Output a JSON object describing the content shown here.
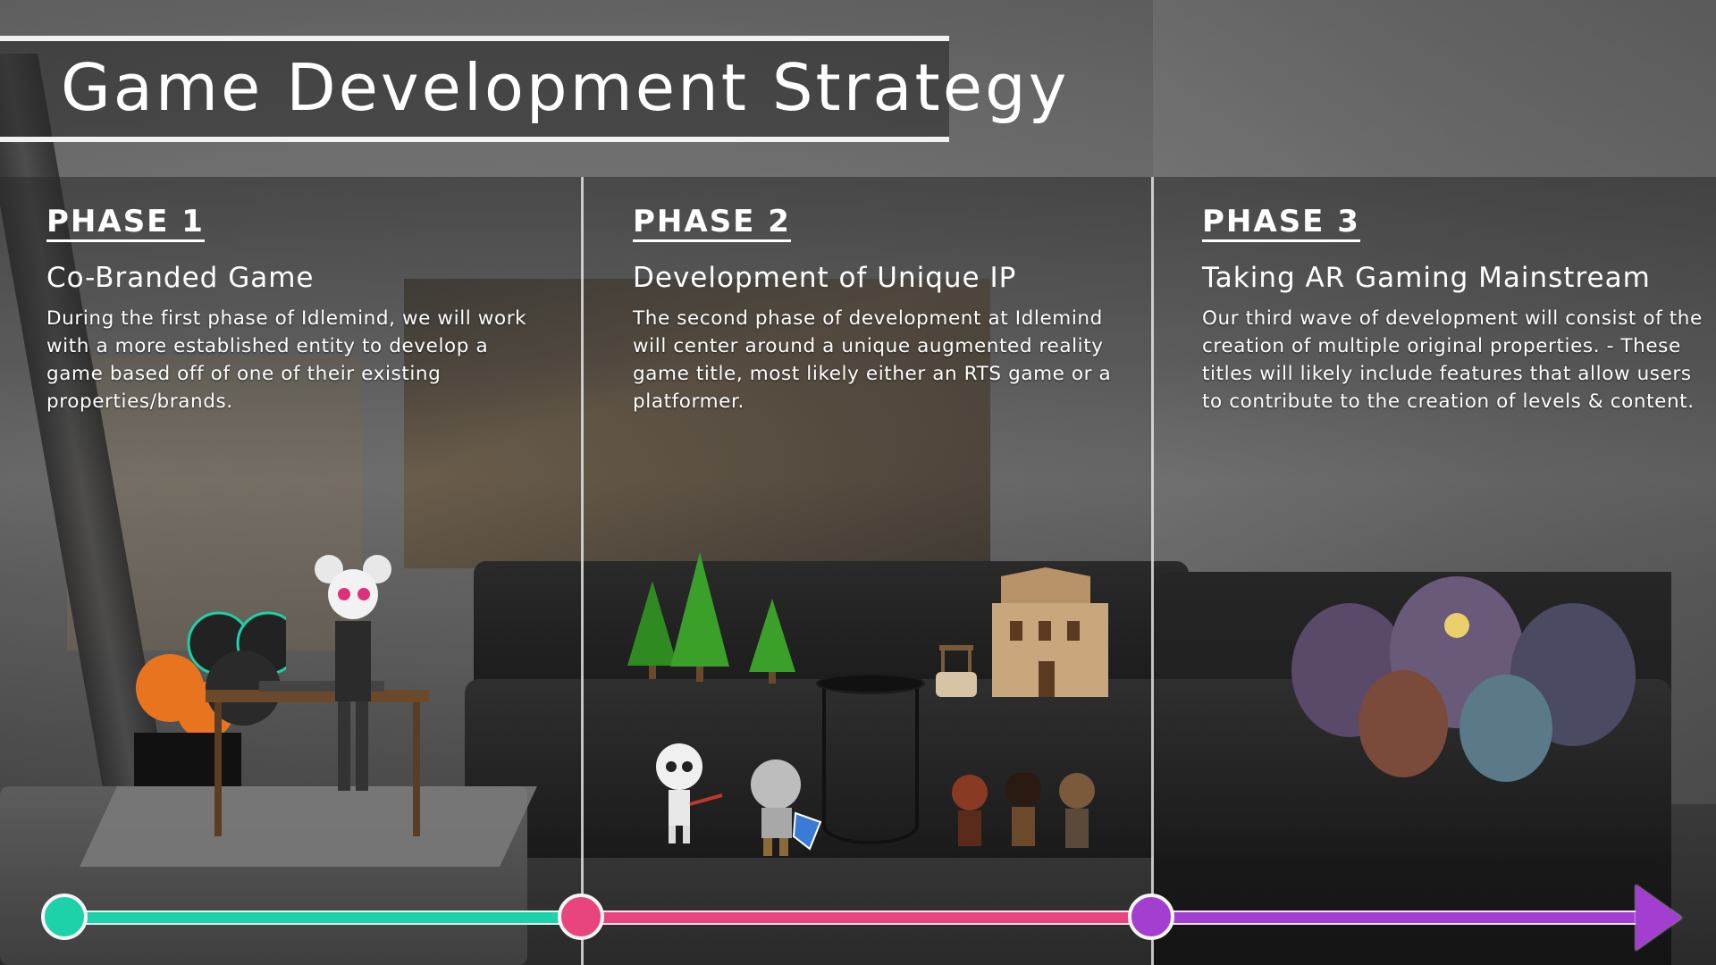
{
  "title": "Game Development Strategy",
  "phases": [
    {
      "label": "PHASE 1",
      "subtitle": "Co-Branded Game",
      "body": "During the first phase of Idlemind, we will work with a more established entity to develop a game based off of one of their existing properties/brands.",
      "color": "#1dd1a8"
    },
    {
      "label": "PHASE 2",
      "subtitle": "Development of Unique IP",
      "body": "The second phase of development at Idlemind will center around a unique augmented reality game title, most likely either an RTS game or a platformer.",
      "color": "#e8457f"
    },
    {
      "label": "PHASE 3",
      "subtitle": "Taking AR Gaming Mainstream",
      "body": "Our third wave of development will consist of the creation of multiple original properties. - These titles will likely include features that allow users to  contribute to the creation of levels & content.",
      "color": "#a33fd0"
    }
  ],
  "timeline": {
    "colors": [
      "#1dd1a8",
      "#e8457f",
      "#a33fd0"
    ],
    "direction": "right-arrow"
  }
}
